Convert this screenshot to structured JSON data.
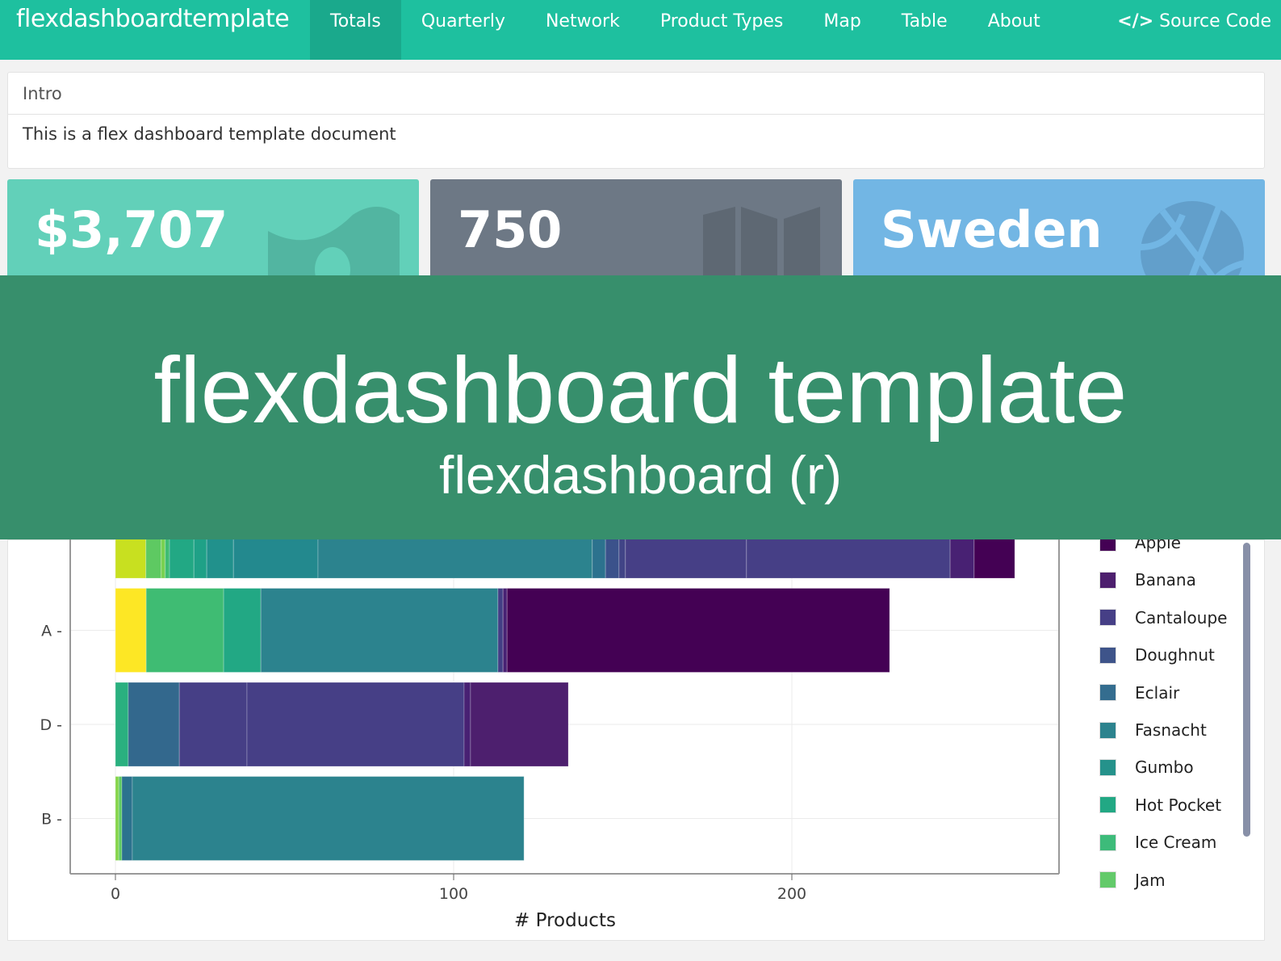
{
  "navbar": {
    "brand": "flexdashboardtemplate",
    "items": [
      {
        "label": "Totals",
        "active": true
      },
      {
        "label": "Quarterly"
      },
      {
        "label": "Network"
      },
      {
        "label": "Product Types"
      },
      {
        "label": "Map"
      },
      {
        "label": "Table"
      },
      {
        "label": "About"
      }
    ],
    "source_code": "Source Code",
    "color": "#1ec09f"
  },
  "intro": {
    "title": "Intro",
    "body": "This is a flex dashboard template document"
  },
  "value_boxes": [
    {
      "value": "$3,707",
      "icon": "money-icon",
      "color": "#62d0b9"
    },
    {
      "value": "750",
      "icon": "map-icon",
      "color": "#6d7885"
    },
    {
      "value": "Sweden",
      "icon": "basketball-icon",
      "color": "#72b6e4"
    }
  ],
  "banner": {
    "title": "flexdashboard template",
    "subtitle": "flexdashboard (r)",
    "color": "#378f6c"
  },
  "chart_data": {
    "type": "bar",
    "orientation": "horizontal",
    "stacked": true,
    "xlabel": "# Products",
    "xlim": [
      -13.5,
      279
    ],
    "xticks": [
      0,
      100,
      200
    ],
    "categories": [
      "",
      "A",
      "D",
      "B"
    ],
    "bars": [
      {
        "category": "",
        "segments": [
          [
            9,
            "#c8e020"
          ],
          [
            4.5,
            "#5ec962"
          ],
          [
            1.2,
            "#7ad151"
          ],
          [
            1.3,
            "#3fbc73"
          ],
          [
            7.2,
            "#22a884"
          ],
          [
            3.8,
            "#1fa187"
          ],
          [
            7.9,
            "#21918c"
          ],
          [
            25,
            "#23898e"
          ],
          [
            81.1,
            "#2c838e"
          ],
          [
            3.9,
            "#2c728e"
          ],
          [
            4,
            "#3b528b"
          ],
          [
            1.9,
            "#414487"
          ],
          [
            35.8,
            "#463f86"
          ],
          [
            60.2,
            "#463f86"
          ],
          [
            7.1,
            "#482173"
          ],
          [
            12,
            "#440154"
          ]
        ]
      },
      {
        "category": "A",
        "segments": [
          [
            9.1,
            "#fde725"
          ],
          [
            22.9,
            "#3fbc73"
          ],
          [
            11,
            "#22a884"
          ],
          [
            70.1,
            "#2c838e"
          ],
          [
            1.5,
            "#433e85"
          ],
          [
            1.2,
            "#482173"
          ],
          [
            113.1,
            "#440154"
          ]
        ]
      },
      {
        "category": "D",
        "segments": [
          [
            3.8,
            "#2ab07f"
          ],
          [
            15.1,
            "#33688d"
          ],
          [
            20,
            "#463f86"
          ],
          [
            64.2,
            "#463f86"
          ],
          [
            1.9,
            "#482173"
          ],
          [
            28.9,
            "#4d1f6e"
          ]
        ]
      },
      {
        "category": "B",
        "segments": [
          [
            1,
            "#85d54a"
          ],
          [
            0.9,
            "#5ec962"
          ],
          [
            3.1,
            "#2c728e"
          ],
          [
            115.8,
            "#2c838e"
          ]
        ]
      }
    ],
    "legend": {
      "position": "right",
      "items": [
        {
          "name": "Apple",
          "color": "#440154"
        },
        {
          "name": "Banana",
          "color": "#4d1f6e"
        },
        {
          "name": "Cantaloupe",
          "color": "#463f86"
        },
        {
          "name": "Doughnut",
          "color": "#3e548a"
        },
        {
          "name": "Eclair",
          "color": "#346d8f"
        },
        {
          "name": "Fasnacht",
          "color": "#2c838e"
        },
        {
          "name": "Gumbo",
          "color": "#25928b"
        },
        {
          "name": "Hot Pocket",
          "color": "#22a884"
        },
        {
          "name": "Ice Cream",
          "color": "#3dbb7a"
        },
        {
          "name": "Jam",
          "color": "#63ca6a"
        }
      ]
    }
  }
}
